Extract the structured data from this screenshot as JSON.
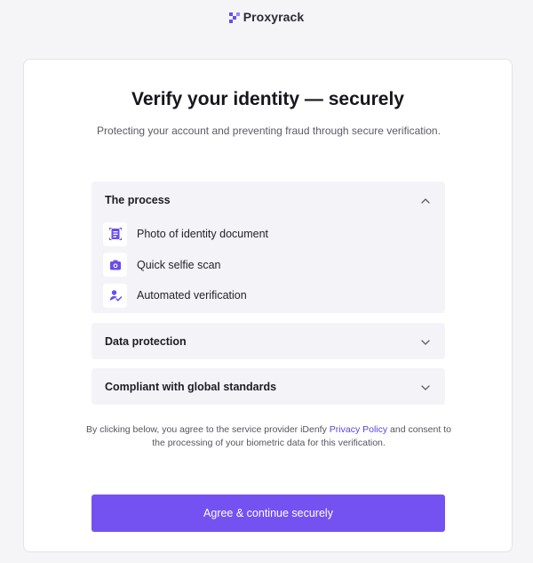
{
  "brand": {
    "name": "Proxyrack",
    "logo_icon": "proxyrack-logo-icon"
  },
  "header": {
    "title": "Verify your identity — securely",
    "subtitle": "Protecting your account and preventing fraud through secure verification."
  },
  "sections": {
    "process": {
      "title": "The process",
      "expanded": true,
      "items": [
        {
          "label": "Photo of identity document",
          "icon": "id-document-icon"
        },
        {
          "label": "Quick selfie scan",
          "icon": "camera-icon"
        },
        {
          "label": "Automated verification",
          "icon": "user-check-icon"
        }
      ]
    },
    "data_protection": {
      "title": "Data protection",
      "expanded": false
    },
    "compliant": {
      "title": "Compliant with global standards",
      "expanded": false
    }
  },
  "consent": {
    "prefix": "By clicking below, you agree to the service provider iDenfy ",
    "link": "Privacy Policy",
    "suffix": " and consent to the processing of your biometric data for this verification."
  },
  "cta": {
    "label": "Agree & continue securely"
  },
  "colors": {
    "accent": "#7452f2",
    "link": "#5b47d8",
    "section_bg": "#f4f4f8",
    "page_bg": "#f5f5f7"
  }
}
